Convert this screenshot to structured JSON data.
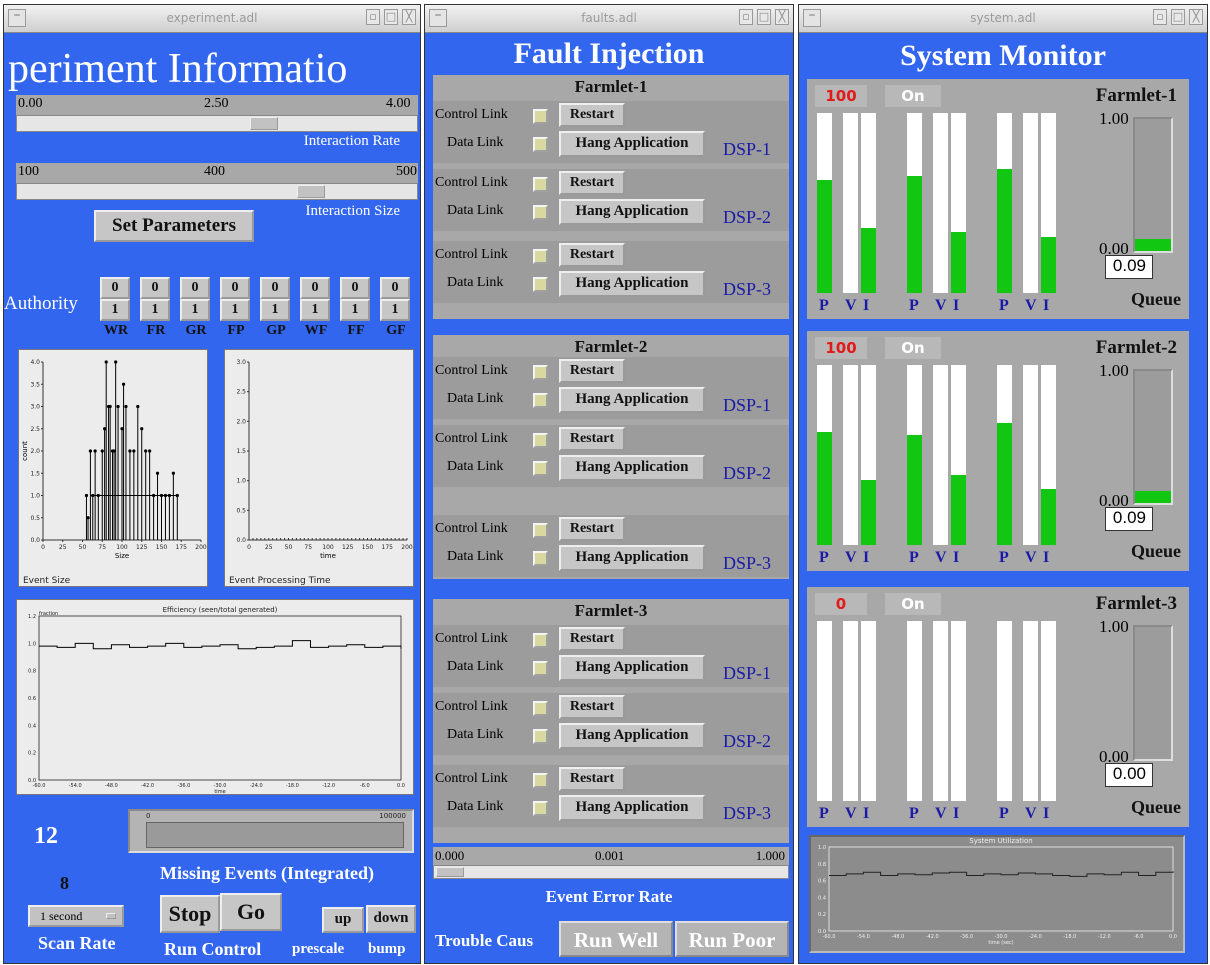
{
  "windows": {
    "experiment": {
      "title": "experiment.adl",
      "heading": "periment Informatio",
      "rate_slider": {
        "min": "0.00",
        "mid": "2.50",
        "max": "4.00",
        "label": "Interaction Rate",
        "value": 2.5
      },
      "size_slider": {
        "min": "100",
        "mid": "400",
        "max": "500",
        "label": "Interaction Size",
        "value": 400
      },
      "set_parameters": "Set Parameters",
      "authority": {
        "label": "Authority",
        "items": [
          {
            "top": "0",
            "bottom": "1",
            "label": "WR"
          },
          {
            "top": "0",
            "bottom": "1",
            "label": "FR"
          },
          {
            "top": "0",
            "bottom": "1",
            "label": "GR"
          },
          {
            "top": "0",
            "bottom": "1",
            "label": "FP"
          },
          {
            "top": "0",
            "bottom": "1",
            "label": "GP"
          },
          {
            "top": "0",
            "bottom": "1",
            "label": "WF"
          },
          {
            "top": "0",
            "bottom": "1",
            "label": "FF"
          },
          {
            "top": "0",
            "bottom": "1",
            "label": "GF"
          }
        ]
      },
      "missing_value": "12",
      "missing_label": "Missing Events (Integrated)",
      "missing_bar": {
        "min": "0",
        "max": "100000"
      },
      "prescale_value": "8",
      "scan_rate_value": "1 second",
      "scan_rate_label": "Scan Rate",
      "stop": "Stop",
      "go": "Go",
      "run_control": "Run Control",
      "up": "up",
      "down": "down",
      "prescale": "prescale",
      "bump": "bump"
    },
    "faults": {
      "title": "faults.adl",
      "heading": "Fault Injection",
      "control_link": "Control Link",
      "data_link": "Data Link",
      "restart": "Restart",
      "hang": "Hang Application",
      "farmlets": [
        {
          "name": "Farmlet-1",
          "dsps": [
            "DSP-1",
            "DSP-2",
            "DSP-3"
          ]
        },
        {
          "name": "Farmlet-2",
          "dsps": [
            "DSP-1",
            "DSP-2",
            "DSP-3"
          ]
        },
        {
          "name": "Farmlet-3",
          "dsps": [
            "DSP-1",
            "DSP-2",
            "DSP-3"
          ]
        }
      ],
      "error_slider": {
        "min": "0.000",
        "mid": "0.001",
        "max": "1.000",
        "label": "Event Error Rate",
        "value": 0
      },
      "trouble": "Trouble Caus",
      "run_well": "Run Well",
      "run_poor": "Run Poor"
    },
    "system": {
      "title": "system.adl",
      "heading": "System Monitor",
      "queue_label": "Queue",
      "scale_max": "1.00",
      "scale_min": "0.00",
      "bar_labels": [
        "P",
        "V",
        "I"
      ],
      "farmlets": [
        {
          "name": "Farmlet-1",
          "count": "100",
          "state": "On",
          "queue": "0.09",
          "queue_level": 0.09,
          "groups": [
            [
              0.63,
              0,
              0.36
            ],
            [
              0.65,
              0,
              0.34
            ],
            [
              0.69,
              0,
              0.31
            ]
          ]
        },
        {
          "name": "Farmlet-2",
          "count": "100",
          "state": "On",
          "queue": "0.09",
          "queue_level": 0.09,
          "groups": [
            [
              0.63,
              0,
              0.36
            ],
            [
              0.61,
              0,
              0.39
            ],
            [
              0.68,
              0,
              0.31
            ]
          ]
        },
        {
          "name": "Farmlet-3",
          "count": "0",
          "state": "On",
          "queue": "0.00",
          "queue_level": 0,
          "groups": [
            [
              0,
              0,
              0
            ],
            [
              0,
              0,
              0
            ],
            [
              0,
              0,
              0
            ]
          ]
        }
      ]
    }
  },
  "chart_data": [
    {
      "type": "bar",
      "title": "",
      "xlabel": "Size",
      "ylabel": "count",
      "xlim": [
        0,
        200
      ],
      "ylim": [
        0,
        4
      ],
      "corner_label": "Event Size",
      "x": [
        55,
        57,
        60,
        63,
        66,
        70,
        75,
        78,
        80,
        83,
        85,
        88,
        90,
        92,
        95,
        100,
        102,
        105,
        110,
        115,
        120,
        125,
        130,
        135,
        140,
        145,
        150,
        155,
        160,
        165,
        170
      ],
      "values": [
        1,
        0.5,
        2,
        1,
        2,
        1,
        2,
        2.5,
        4,
        3,
        3,
        2,
        2,
        4,
        3,
        2.5,
        3.5,
        3,
        2,
        2,
        3,
        2.5,
        2,
        2,
        1,
        1.5,
        1,
        1,
        1,
        1.5,
        1
      ]
    },
    {
      "type": "line",
      "title": "",
      "xlabel": "time",
      "ylabel": "",
      "xlim": [
        0,
        200
      ],
      "ylim": [
        0,
        3
      ],
      "corner_label": "Event Processing Time",
      "x": [],
      "values": []
    },
    {
      "type": "line",
      "title": "Efficiency (seen/total generated)",
      "ylabel": "fraction",
      "xlabel": "time",
      "xlim": [
        -60,
        0
      ],
      "ylim": [
        0,
        1.2
      ],
      "x": [
        -60,
        -57,
        -54,
        -51,
        -48,
        -45,
        -42,
        -39,
        -36,
        -33,
        -30,
        -27,
        -24,
        -21,
        -18,
        -15,
        -12,
        -9,
        -6,
        -3,
        0
      ],
      "values": [
        0.98,
        0.97,
        1.0,
        0.96,
        0.99,
        0.97,
        0.98,
        1.0,
        0.97,
        0.98,
        0.99,
        0.96,
        0.97,
        0.98,
        1.02,
        0.97,
        0.98,
        0.99,
        0.97,
        0.98,
        0.96
      ]
    },
    {
      "type": "line",
      "title": "System Utilization",
      "xlabel": "time (sec)",
      "ylabel": "",
      "xlim": [
        -60,
        0
      ],
      "ylim": [
        0,
        1
      ],
      "x": [
        -60,
        -57,
        -54,
        -51,
        -48,
        -45,
        -42,
        -39,
        -36,
        -33,
        -30,
        -27,
        -24,
        -21,
        -18,
        -15,
        -12,
        -9,
        -6,
        -3,
        0
      ],
      "values": [
        0.66,
        0.68,
        0.7,
        0.66,
        0.68,
        0.67,
        0.69,
        0.7,
        0.66,
        0.68,
        0.67,
        0.69,
        0.68,
        0.66,
        0.65,
        0.68,
        0.67,
        0.7,
        0.66,
        0.7,
        0.71
      ]
    }
  ]
}
